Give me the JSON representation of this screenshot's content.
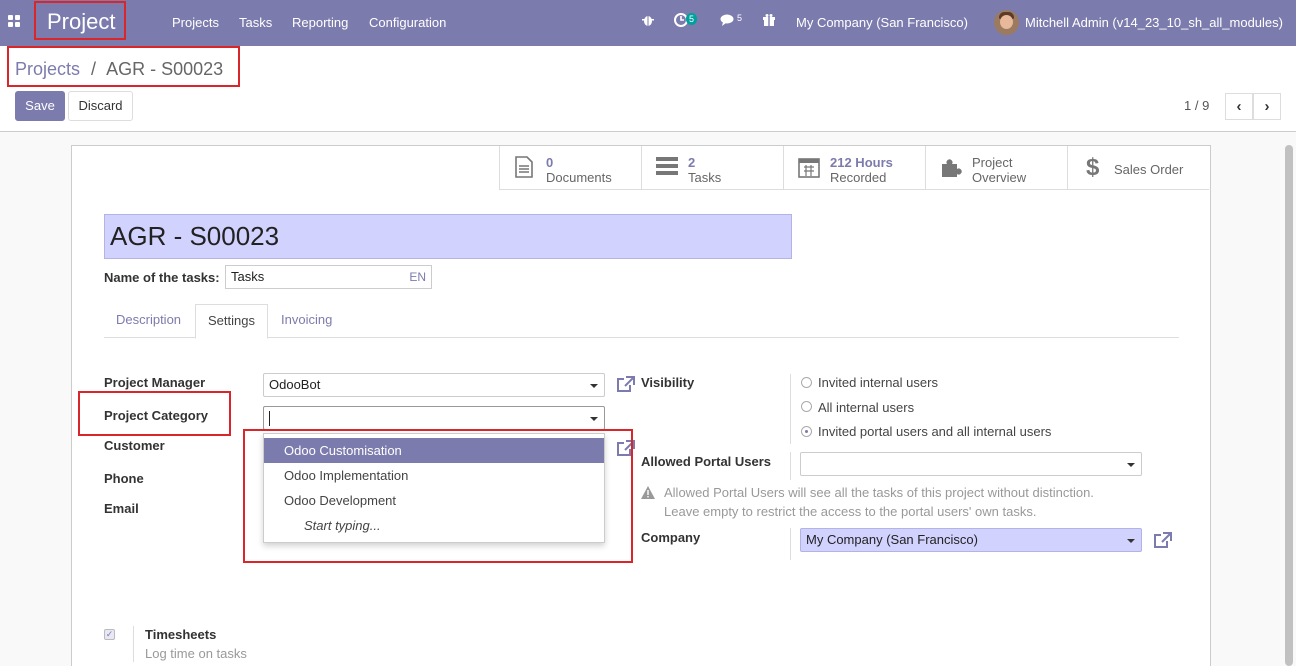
{
  "navbar": {
    "app_title": "Project",
    "menu": [
      "Projects",
      "Tasks",
      "Reporting",
      "Configuration"
    ],
    "activity_count": "5",
    "messages_count": "5",
    "company": "My Company (San Francisco)",
    "user": "Mitchell Admin (v14_23_10_sh_all_modules)"
  },
  "breadcrumb": {
    "parent": "Projects",
    "separator": "/",
    "current": "AGR - S00023"
  },
  "actions": {
    "save": "Save",
    "discard": "Discard"
  },
  "pager": {
    "text": "1 / 9",
    "prev": "‹",
    "next": "›"
  },
  "smart_buttons": [
    {
      "icon": "document-icon",
      "value": "0",
      "label": "Documents"
    },
    {
      "icon": "tasks-icon",
      "value": "2",
      "label": "Tasks"
    },
    {
      "icon": "calendar-icon",
      "value": "212 Hours",
      "label": "Recorded"
    },
    {
      "icon": "puzzle-icon",
      "value": "Project",
      "label": "Overview"
    },
    {
      "icon": "dollar-icon",
      "value": "",
      "label": "Sales Order"
    }
  ],
  "form": {
    "name": "AGR - S00023",
    "tasks_label": "Name of the tasks:",
    "tasks_value": "Tasks",
    "lang": "EN",
    "tabs": [
      "Description",
      "Settings",
      "Invoicing"
    ],
    "active_tab": "Settings",
    "left": {
      "project_manager_label": "Project Manager",
      "project_manager_value": "OdooBot",
      "project_category_label": "Project Category",
      "project_category_value": "",
      "customer_label": "Customer",
      "phone_label": "Phone",
      "email_label": "Email"
    },
    "right": {
      "visibility_label": "Visibility",
      "visibility_options": [
        "Invited internal users",
        "All internal users",
        "Invited portal users and all internal users"
      ],
      "visibility_selected": 2,
      "portal_users_label": "Allowed Portal Users",
      "portal_users_value": "",
      "help_line1": "Allowed Portal Users will see all the tasks of this project without distinction.",
      "help_line2": "Leave empty to restrict the access to the portal users' own tasks.",
      "company_label": "Company",
      "company_value": "My Company (San Francisco)"
    },
    "timesheets": {
      "label": "Timesheets",
      "help": "Log time on tasks",
      "checked": true
    }
  },
  "category_dropdown": {
    "options": [
      "Odoo Customisation",
      "Odoo Implementation",
      "Odoo Development"
    ],
    "highlighted": 0,
    "hint": "Start typing..."
  },
  "colors": {
    "brand": "#7c7bad",
    "highlight": "#d2d2ff",
    "annotation": "#d9262b"
  }
}
